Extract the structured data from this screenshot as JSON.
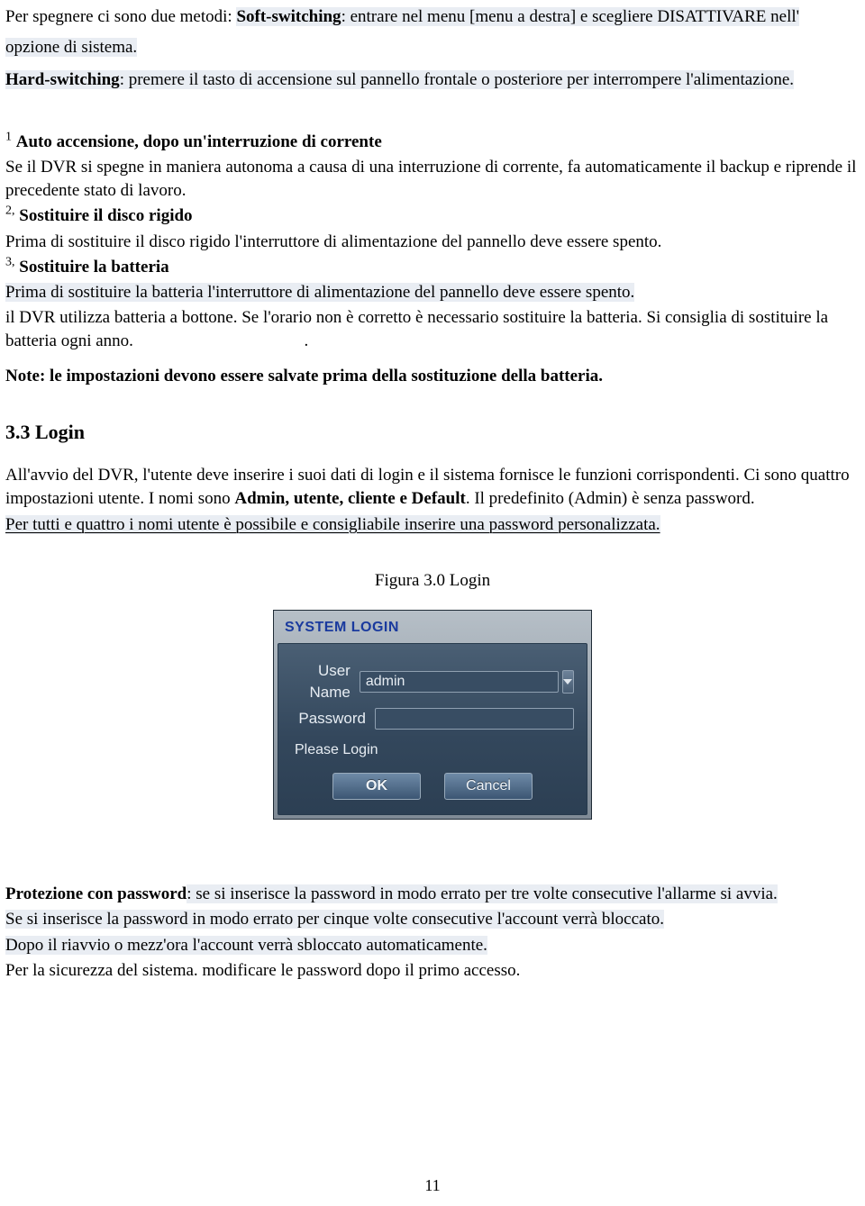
{
  "shutdown": {
    "intro": "Per spegnere ci sono due metodi: ",
    "soft_label": "Soft-switching",
    "soft_text1": ": entrare nel menu [menu a destra] e scegliere DISATTIVARE nell'",
    "soft_text2": "opzione di sistema.",
    "hard_label": "Hard-switching",
    "hard_text": ": premere il tasto di accensione sul pannello frontale o posteriore per interrompere l'alimentazione."
  },
  "items": {
    "n1": "1",
    "t1": "Auto accensione, dopo un'interruzione di corrente",
    "p1": "Se il DVR si spegne in maniera autonoma a causa di una interruzione di corrente, fa automaticamente il backup e riprende il precedente stato di lavoro.",
    "n2": "2,",
    "t2": "Sostituire il disco rigido",
    "p2": "Prima di sostituire il disco rigido l'interruttore di alimentazione del pannello deve essere spento.",
    "n3": "3,",
    "t3": "Sostituire la batteria",
    "p3a": "Prima di sostituire la batteria l'interruttore di alimentazione del pannello deve essere spento.",
    "p3b": "il DVR utilizza batteria a bottone. Se l'orario non è corretto è necessario sostituire la batteria. Si consiglia di sostituire la batteria ogni anno.",
    "dot": "."
  },
  "note": "Note: le impostazioni devono essere salvate prima della sostituzione della batteria.",
  "section": "3.3 Login",
  "login_desc": {
    "p1": "All'avvio del DVR, l'utente deve inserire i suoi dati di login e il sistema fornisce le funzioni corrispondenti. Ci sono quattro impostazioni utente. I nomi sono ",
    "names": "Admin, utente, cliente e Default",
    "p2": ". Il predefinito (Admin) è senza password.",
    "p3": "Per tutti e quattro i nomi utente è possibile e consigliabile inserire una password personalizzata."
  },
  "figure_caption": "Figura 3.0 Login",
  "dialog": {
    "title": "SYSTEM LOGIN",
    "user_label": "User Name",
    "user_value": "admin",
    "pass_label": "Password",
    "pass_value": "",
    "please": "Please Login",
    "ok": "OK",
    "cancel": "Cancel"
  },
  "protection": {
    "label": "Protezione con password",
    "s1": ": se si inserisce la password in modo errato per tre volte consecutive l'allarme si avvia.",
    "s2": "Se si inserisce la password in modo errato per cinque volte consecutive l'account verrà bloccato.",
    "s3": "Dopo il riavvio o mezz'ora l'account verrà sbloccato automaticamente.",
    "s4": "Per la sicurezza del sistema. modificare le password dopo il primo accesso."
  },
  "page_number": "11"
}
